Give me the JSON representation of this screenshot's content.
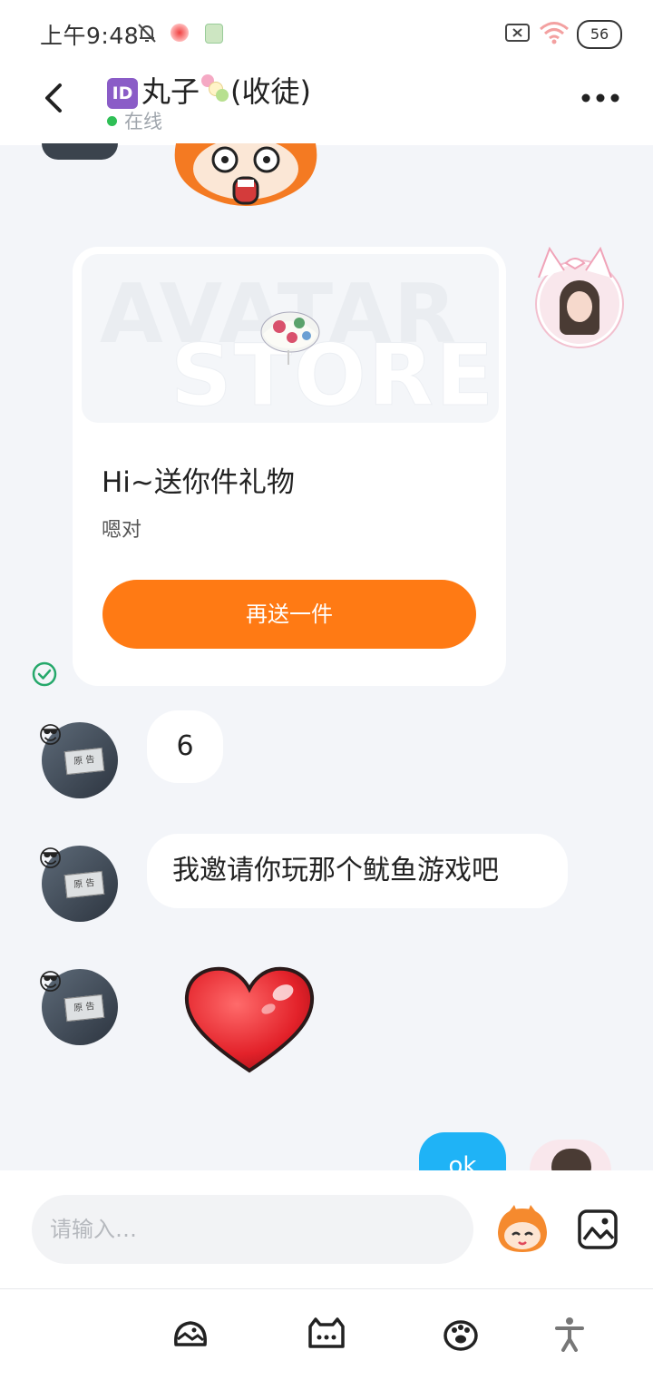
{
  "status_bar": {
    "time": "上午9:48",
    "battery": "56",
    "icons": [
      "bell-off-icon",
      "notification-app-icon",
      "notification-app-icon-2",
      "sim-error-icon",
      "wifi-icon",
      "battery-icon"
    ]
  },
  "header": {
    "title": "丸子",
    "title_suffix": "(收徒)",
    "id_badge": "ID",
    "online_status": "在线",
    "back_icon": "back-arrow-icon",
    "more_icon": "more-dots-icon"
  },
  "gift_card": {
    "image_watermark_top": "AVATAR",
    "image_watermark_bottom": "STORE",
    "title": "Hi~送你件礼物",
    "subtitle": "嗯对",
    "button_label": "再送一件"
  },
  "messages": [
    {
      "from": "other",
      "type": "text",
      "text": "6"
    },
    {
      "from": "other",
      "type": "text",
      "text": "我邀请你玩那个鱿鱼游戏吧"
    },
    {
      "from": "other",
      "type": "sticker",
      "sticker": "heart-sticker"
    },
    {
      "from": "me",
      "type": "text",
      "text": "ok"
    }
  ],
  "avatar_plaque_text": "原 告",
  "input": {
    "placeholder": "请输入…"
  },
  "toolbar": [
    "scene-icon",
    "cat-chat-icon",
    "paw-icon",
    "person-icon"
  ],
  "colors": {
    "accent_orange": "#ff7a14",
    "my_bubble": "#1fb3f6",
    "online_green": "#2fbf56",
    "background": "#f3f5f9"
  }
}
